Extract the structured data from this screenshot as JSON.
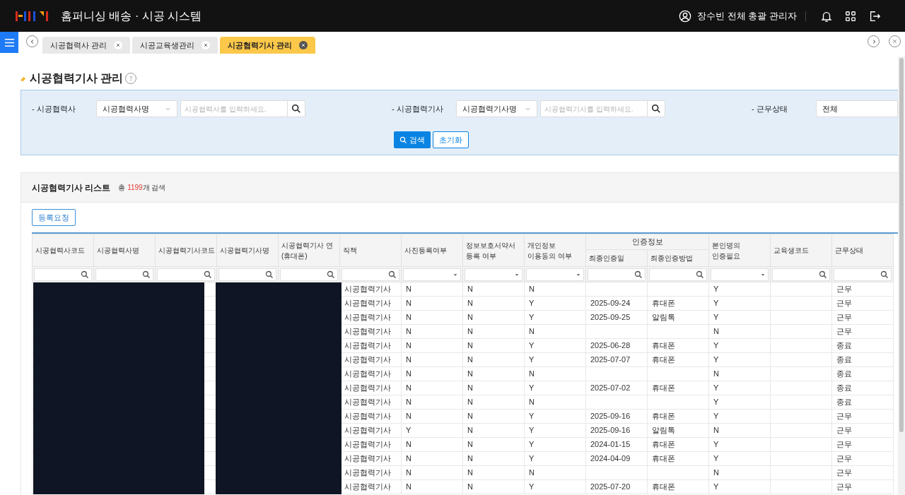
{
  "header": {
    "title": "홈퍼니싱 배송 · 시공 시스템",
    "user": "장수빈 전체 총괄 관리자"
  },
  "tabs": [
    {
      "label": "시공협력사 관리",
      "selected": false
    },
    {
      "label": "시공교육생관리",
      "selected": false
    },
    {
      "label": "시공협력기사 관리",
      "selected": true
    }
  ],
  "page_title": "시공협력기사 관리",
  "filters": [
    {
      "label": "- 시공협력사",
      "select": "시공협력사명",
      "placeholder": "시공협력사를 입력하세요."
    },
    {
      "label": "- 시공협력기사",
      "select": "시공협력기사명",
      "placeholder": "시공협력기사를 입력하세요."
    },
    {
      "label": "- 근무상태",
      "select": "전체"
    }
  ],
  "search_button": "검색",
  "reset_button": "초기화",
  "list": {
    "title": "시공협력기사 리스트",
    "count_prefix": "총",
    "count": "1199",
    "count_suffix": "개 검색",
    "register_button": "등록요청"
  },
  "table": {
    "columns": [
      {
        "kind": "single",
        "lines": [
          "시공협력사코드"
        ],
        "filter": {
          "kind": "search"
        }
      },
      {
        "kind": "single",
        "lines": [
          "시공협력사명"
        ],
        "filter": {
          "kind": "search"
        }
      },
      {
        "kind": "single",
        "lines": [
          "시공협력기사코드"
        ],
        "filter": {
          "kind": "search"
        }
      },
      {
        "kind": "single",
        "lines": [
          "시공협력기사명"
        ],
        "filter": {
          "kind": "search"
        }
      },
      {
        "kind": "single",
        "lines": [
          "시공협력기사 연",
          "(휴대폰)"
        ],
        "filter": {
          "kind": "search"
        }
      },
      {
        "kind": "single",
        "lines": [
          "직책"
        ],
        "filter": {
          "kind": "search"
        }
      },
      {
        "kind": "single",
        "lines": [
          "사진등록여부"
        ],
        "filter": {
          "kind": "dropdown"
        }
      },
      {
        "kind": "single",
        "lines": [
          "정보보호서약서",
          "등록 여부"
        ],
        "filter": {
          "kind": "dropdown"
        }
      },
      {
        "kind": "single",
        "lines": [
          "개인정보",
          "이용동의 여부"
        ],
        "filter": {
          "kind": "dropdown"
        }
      },
      {
        "kind": "group",
        "label": "인증정보",
        "children": [
          {
            "lines": [
              "최종인증일"
            ],
            "filter": {
              "kind": "search"
            }
          },
          {
            "lines": [
              "최종인증방법"
            ],
            "filter": {
              "kind": "search"
            }
          }
        ]
      },
      {
        "kind": "single",
        "lines": [
          "본인명의",
          "인증필요"
        ],
        "filter": {
          "kind": "dropdown"
        }
      },
      {
        "kind": "single",
        "lines": [
          "교육생코드"
        ],
        "filter": {
          "kind": "search"
        }
      },
      {
        "kind": "single",
        "lines": [
          "근무상태"
        ],
        "filter": {
          "kind": "search"
        }
      }
    ],
    "rows": [
      {
        "role": "시공협력기사",
        "photo": "N",
        "security": "N",
        "privacy": "N",
        "self_auth": "Y",
        "status": "근무"
      },
      {
        "role": "시공협력기사",
        "photo": "N",
        "security": "N",
        "privacy": "Y",
        "cert_date": "2025-09-24",
        "cert_method": "휴대폰",
        "self_auth": "Y",
        "status": "근무"
      },
      {
        "role": "시공협력기사",
        "photo": "N",
        "security": "N",
        "privacy": "Y",
        "cert_date": "2025-09-25",
        "cert_method": "알림톡",
        "self_auth": "Y",
        "status": "근무"
      },
      {
        "role": "시공협력기사",
        "photo": "N",
        "security": "N",
        "privacy": "N",
        "self_auth": "N",
        "status": "근무"
      },
      {
        "role": "시공협력기사",
        "photo": "N",
        "security": "N",
        "privacy": "Y",
        "cert_date": "2025-06-28",
        "cert_method": "휴대폰",
        "self_auth": "Y",
        "status": "종료"
      },
      {
        "role": "시공협력기사",
        "photo": "N",
        "security": "N",
        "privacy": "Y",
        "cert_date": "2025-07-07",
        "cert_method": "휴대폰",
        "self_auth": "Y",
        "status": "종료"
      },
      {
        "role": "시공협력기사",
        "photo": "N",
        "security": "N",
        "privacy": "N",
        "self_auth": "N",
        "status": "종료"
      },
      {
        "role": "시공협력기사",
        "photo": "N",
        "security": "N",
        "privacy": "Y",
        "cert_date": "2025-07-02",
        "cert_method": "휴대폰",
        "self_auth": "Y",
        "status": "종료"
      },
      {
        "role": "시공협력기사",
        "photo": "N",
        "security": "N",
        "privacy": "N",
        "self_auth": "Y",
        "status": "종료"
      },
      {
        "role": "시공협력기사",
        "photo": "N",
        "security": "N",
        "privacy": "Y",
        "cert_date": "2025-09-16",
        "cert_method": "휴대폰",
        "self_auth": "Y",
        "status": "근무"
      },
      {
        "role": "시공협력기사",
        "photo": "Y",
        "security": "N",
        "privacy": "Y",
        "cert_date": "2025-09-16",
        "cert_method": "알림톡",
        "self_auth": "N",
        "status": "근무"
      },
      {
        "role": "시공협력기사",
        "photo": "N",
        "security": "N",
        "privacy": "Y",
        "cert_date": "2024-01-15",
        "cert_method": "휴대폰",
        "self_auth": "Y",
        "status": "근무"
      },
      {
        "role": "시공협력기사",
        "photo": "N",
        "security": "N",
        "privacy": "Y",
        "cert_date": "2024-04-09",
        "cert_method": "휴대폰",
        "self_auth": "Y",
        "status": "근무"
      },
      {
        "role": "시공협력기사",
        "photo": "N",
        "security": "N",
        "privacy": "N",
        "self_auth": "N",
        "status": "근무"
      },
      {
        "role": "시공협력기사",
        "photo": "N",
        "security": "N",
        "privacy": "Y",
        "cert_date": "2025-07-20",
        "cert_method": "휴대폰",
        "self_auth": "Y",
        "status": "근무"
      }
    ]
  }
}
